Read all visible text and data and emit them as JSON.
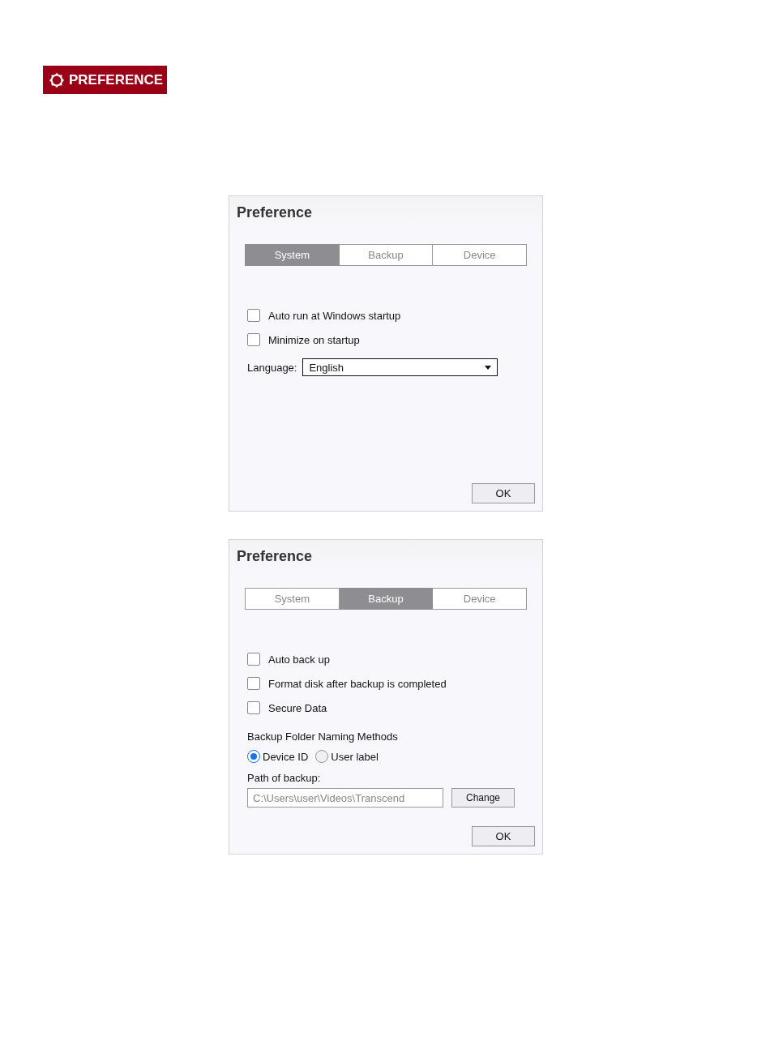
{
  "header": {
    "label": "PREFERENCE"
  },
  "dialogs": [
    {
      "title": "Preference",
      "tabs": [
        {
          "label": "System",
          "selected": true
        },
        {
          "label": "Backup",
          "selected": false
        },
        {
          "label": "Device",
          "selected": false
        }
      ],
      "items": [
        {
          "kind": "checkbox",
          "label": "Auto run at Windows startup",
          "checked": false
        },
        {
          "kind": "checkbox",
          "label": "Minimize on startup",
          "checked": false
        },
        {
          "kind": "dropdown",
          "label": "Language:",
          "value": "English"
        }
      ],
      "ok": "OK"
    },
    {
      "title": "Preference",
      "tabs": [
        {
          "label": "System",
          "selected": false
        },
        {
          "label": "Backup",
          "selected": true
        },
        {
          "label": "Device",
          "selected": false
        }
      ],
      "items": [
        {
          "kind": "checkbox",
          "label": "Auto back up",
          "checked": false
        },
        {
          "kind": "checkbox",
          "label": "Format disk after backup is completed",
          "checked": false
        },
        {
          "kind": "checkbox",
          "label": "Secure Data",
          "checked": false
        },
        {
          "kind": "heading",
          "label": "Backup Folder Naming Methods"
        },
        {
          "kind": "radios",
          "options": [
            {
              "label": "Device ID",
              "selected": true
            },
            {
              "label": "User label",
              "selected": false
            }
          ]
        },
        {
          "kind": "path",
          "label": "Path of backup:",
          "value": "C:\\Users\\user\\Videos\\Transcend",
          "button": "Change"
        }
      ],
      "ok": "OK"
    }
  ]
}
